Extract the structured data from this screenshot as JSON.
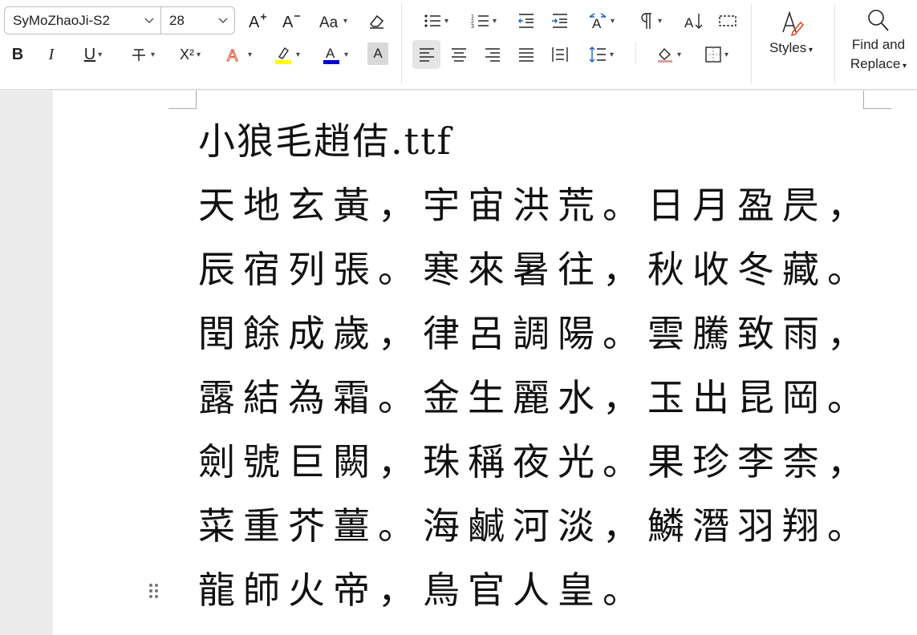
{
  "toolbar": {
    "font_name": "SyMoZhaoJi-S2",
    "font_size": "28",
    "styles_label": "Styles",
    "find_replace_line1": "Find and",
    "find_replace_line2": "Replace",
    "icons": [
      "increase-font-size-icon",
      "decrease-font-size-icon",
      "change-case-icon",
      "clear-formatting-icon",
      "bullets-icon",
      "numbering-icon",
      "decrease-indent-icon",
      "increase-indent-icon",
      "text-direction-icon",
      "paragraph-marks-icon",
      "sort-icon",
      "show-gridlines-icon",
      "bold-icon",
      "italic-icon",
      "underline-icon",
      "strikethrough-icon",
      "superscript-icon",
      "text-effects-icon",
      "highlight-icon",
      "font-color-icon",
      "character-shading-icon",
      "align-left-icon",
      "align-center-icon",
      "align-right-icon",
      "justify-icon",
      "distributed-icon",
      "line-spacing-icon",
      "shading-icon",
      "borders-icon",
      "styles-icon",
      "search-icon"
    ],
    "labels": {
      "bold": "B",
      "italic": "I",
      "underline": "U",
      "superscript": "X²",
      "shading_letter": "A"
    },
    "colors": {
      "highlight": "#ffff00",
      "font_color": "#0000cc",
      "active_bg": "#e5e5e5"
    }
  },
  "document": {
    "lines": [
      "小狼毛趙佶.ttf",
      "天地玄黃，宇宙洪荒。日月盈昃，",
      "辰宿列張。寒來暑往，秋收冬藏。",
      "閏餘成歲，律呂調陽。雲騰致雨，",
      "露結為霜。金生麗水，玉出昆岡。",
      "劍號巨闕，珠稱夜光。果珍李柰，",
      "菜重芥薑。海鹹河淡，鱗潛羽翔。",
      "龍師火帝，鳥官人皇。"
    ]
  }
}
